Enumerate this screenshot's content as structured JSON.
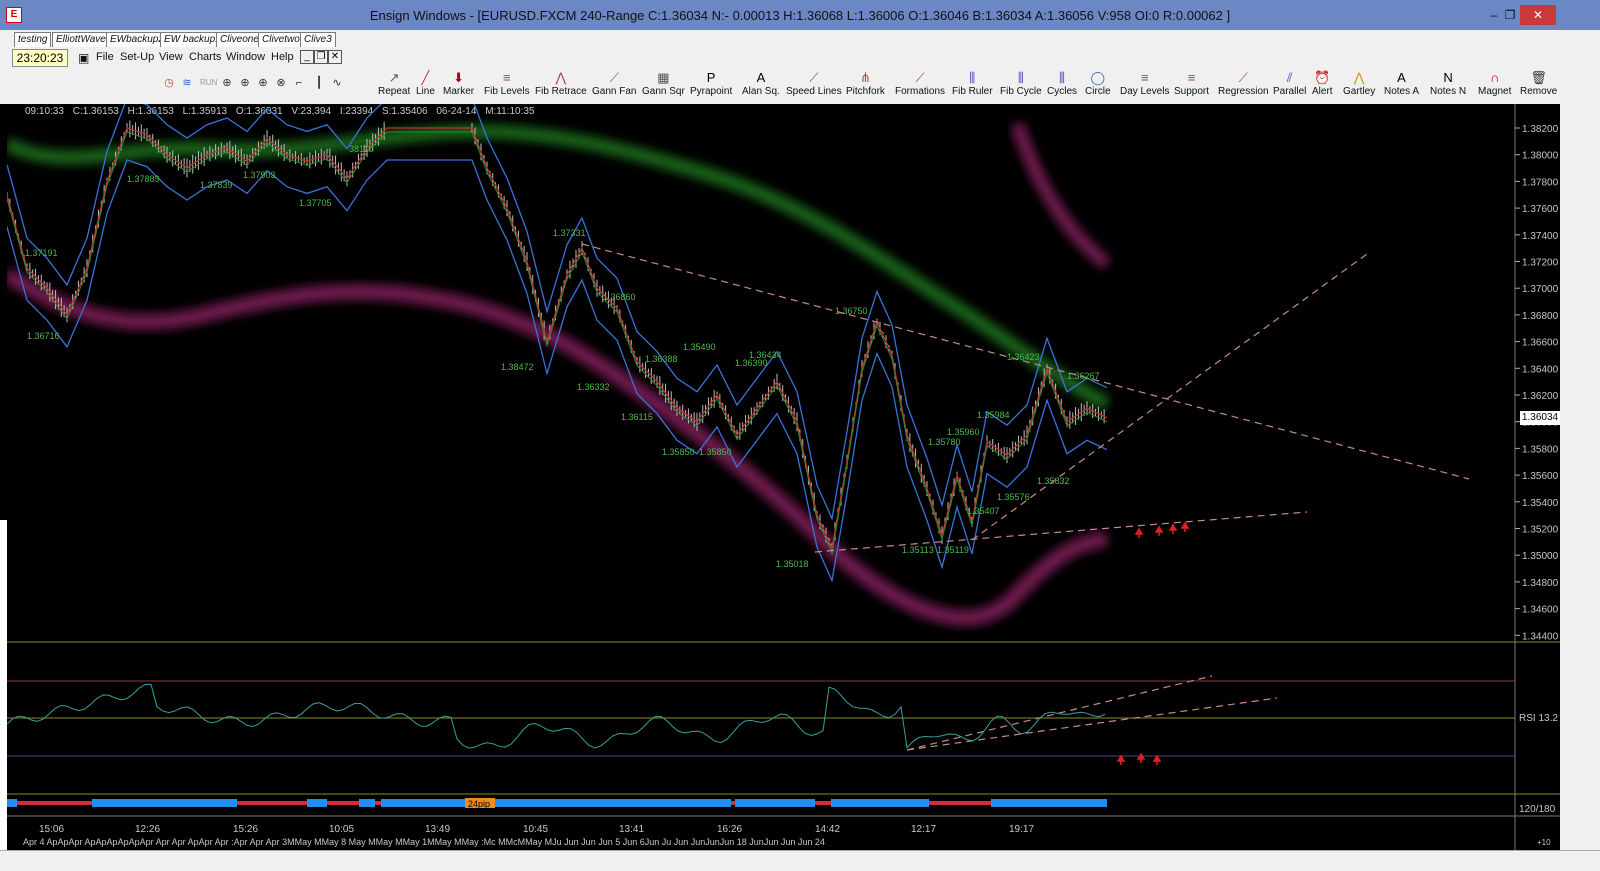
{
  "window": {
    "title": "Ensign Windows - [EURUSD.FXCM 240-Range C:1.36034 N:- 0.00013 H:1.36068 L:1.36006 O:1.36046 B:1.36034 A:1.36056 V:958 OI:0 R:0.00062 ]",
    "minimize": "–",
    "restore": "❐",
    "close": "✕"
  },
  "tabs": [
    "testing",
    "ElliottWave",
    "EWbackup2",
    "EW backup1",
    "Cliveone",
    "Clivetwo",
    "Clive3"
  ],
  "clock": "23:20:23",
  "menu": [
    "File",
    "Set-Up",
    "View",
    "Charts",
    "Window",
    "Help"
  ],
  "mdi_buttons": [
    "_",
    "❐",
    "✕"
  ],
  "toolbar": [
    {
      "label": "Repeat",
      "icon": "repeat-icon"
    },
    {
      "label": "Line",
      "icon": "line-icon"
    },
    {
      "label": "Marker",
      "icon": "marker-icon"
    },
    {
      "label": "Fib Levels",
      "icon": "fib-levels-icon"
    },
    {
      "label": "Fib Retrace",
      "icon": "fib-retrace-icon"
    },
    {
      "label": "Gann Fan",
      "icon": "gann-fan-icon"
    },
    {
      "label": "Gann Sqr",
      "icon": "gann-square-icon"
    },
    {
      "label": "Pyrapoint",
      "icon": "pyrapoint-icon"
    },
    {
      "label": "Alan Sq.",
      "icon": "alan-square-icon"
    },
    {
      "label": "Speed Lines",
      "icon": "speed-lines-icon"
    },
    {
      "label": "Pitchfork",
      "icon": "pitchfork-icon"
    },
    {
      "label": "Formations",
      "icon": "formations-icon"
    },
    {
      "label": "Fib Ruler",
      "icon": "fib-ruler-icon"
    },
    {
      "label": "Fib Cycle",
      "icon": "fib-cycle-icon"
    },
    {
      "label": "Cycles",
      "icon": "cycles-icon"
    },
    {
      "label": "Circle",
      "icon": "circle-icon"
    },
    {
      "label": "Day Levels",
      "icon": "day-levels-icon"
    },
    {
      "label": "Support",
      "icon": "support-icon"
    },
    {
      "label": "Regression",
      "icon": "regression-icon"
    },
    {
      "label": "Parallel",
      "icon": "parallel-icon"
    },
    {
      "label": "Alert",
      "icon": "alert-icon"
    },
    {
      "label": "Gartley",
      "icon": "gartley-icon"
    },
    {
      "label": "Notes A",
      "icon": "notes-a-icon"
    },
    {
      "label": "Notes N",
      "icon": "notes-n-icon"
    },
    {
      "label": "Magnet",
      "icon": "magnet-icon"
    },
    {
      "label": "Remove",
      "icon": "remove-icon"
    }
  ],
  "infobar": {
    "time": "09:10:33",
    "close": "C:1.36153",
    "high": "H:1.36153",
    "low": "L:1.35913",
    "open": "O:1.36031",
    "volume": "V:23,394",
    "i": "I:23394",
    "s": "S:1.35406",
    "date": "06-24-14",
    "m": "M:11:10:35"
  },
  "price_axis": [
    "1.38200",
    "1.38000",
    "1.37800",
    "1.37600",
    "1.37400",
    "1.37200",
    "1.37000",
    "1.36800",
    "1.36600",
    "1.36400",
    "1.36200",
    "1.36000",
    "1.35800",
    "1.35600",
    "1.35400",
    "1.35200",
    "1.35000",
    "1.34800",
    "1.34600",
    "1.34400"
  ],
  "last_price": "1.36034",
  "chart_labels": [
    "1.37889",
    "1.37839",
    "1.37903",
    "1.37705",
    "38110",
    "1.36716",
    "1.37191",
    "1.38472",
    "1.37331",
    "1.36860",
    "1.36332",
    "1.36115",
    "1.36388",
    "1.35490",
    "1.35850",
    "1.35850",
    "1.36390",
    "1.36434",
    "1.36750",
    "1.35018",
    "1.35780",
    "1.35984",
    "1.35960",
    "1.36423",
    "1.36267",
    "1.35407",
    "1.35576",
    "1.35832",
    "1.35113",
    "1.35119"
  ],
  "rsi": {
    "label": "RSI",
    "value": "13.2"
  },
  "bar_label": "24pip",
  "bar_ratio": "120/180",
  "time_axis_top": [
    "15:06",
    "12:26",
    "15:26",
    "10:05",
    "13:49",
    "10:45",
    "13:41",
    "16:26",
    "14:42",
    "12:17",
    "19:17"
  ],
  "time_axis_bottom": "Apr 4   ApApApr ApApApApApApr Apr Apr ApApr Apr :Apr Apr Apr 3MMay MMay 8   May MMay MMay 1MMay MMay :Mc MMcMMay MJu Jun Jun Jun 5   Jun 6Jun Ju Jun JunJunJun 18 JunJun Jun Jun 24",
  "axis_corner": "+10"
}
